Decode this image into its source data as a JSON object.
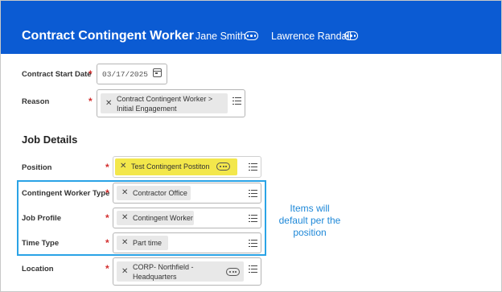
{
  "header": {
    "title": "Contract Contingent Worker",
    "person1": "Jane Smith",
    "person2": "Lawrence Randall"
  },
  "fields": {
    "start_date": {
      "label": "Contract Start Date",
      "value": "03/17/2025",
      "required": "*"
    },
    "reason": {
      "label": "Reason",
      "line1": "Contract Contingent Worker >",
      "line2": "Initial Engagement",
      "required": "*"
    }
  },
  "job_details": {
    "heading": "Job Details",
    "position": {
      "label": "Position",
      "value": "Test Contingent Postiton",
      "required": "*",
      "highlight_color": "#f3e74b"
    },
    "worker_type": {
      "label": "Contingent Worker Type",
      "value": "Contractor Office",
      "required": "*"
    },
    "job_profile": {
      "label": "Job Profile",
      "value": "Contingent Worker",
      "required": "*"
    },
    "time_type": {
      "label": "Time Type",
      "value": "Part time",
      "required": "*"
    },
    "location": {
      "label": "Location",
      "line1": "CORP- Northfield -",
      "line2": "Headquarters",
      "required": "*"
    }
  },
  "annotation": {
    "line1": "Items will",
    "line2": "default per the",
    "line3": "position",
    "color": "#2aa3e6"
  },
  "colors": {
    "header_bg": "#0b5bd3",
    "required": "#d32f2f"
  },
  "icons": [
    "more-icon",
    "calendar-icon",
    "remove-icon",
    "list-icon"
  ]
}
